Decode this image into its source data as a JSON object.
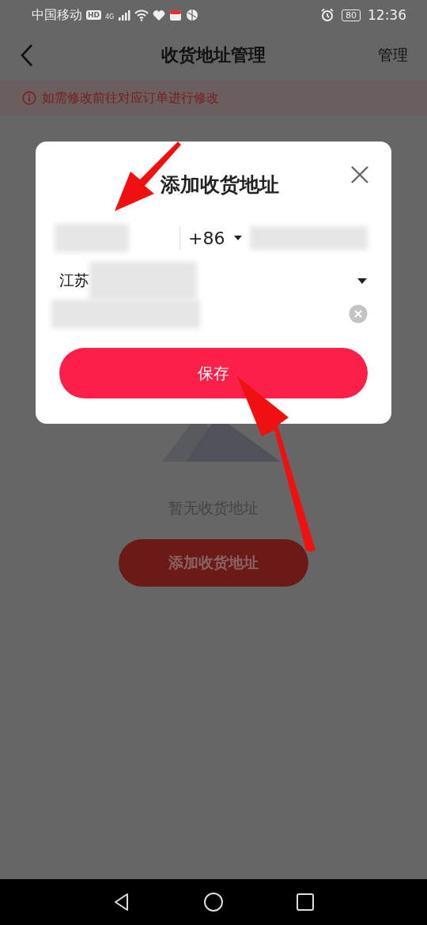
{
  "status_bar": {
    "carrier": "中国移动",
    "hd": "HD",
    "network": "4G",
    "battery": "80",
    "time": "12:36"
  },
  "header": {
    "title": "收货地址管理",
    "action": "管理"
  },
  "notice": "如需修改前往对应订单进行修改",
  "empty_state": {
    "message": "暂无收货地址",
    "button": "添加收货地址"
  },
  "dialog": {
    "title": "添加收货地址",
    "country_code": "+86",
    "region": "江苏",
    "save_button": "保存"
  }
}
